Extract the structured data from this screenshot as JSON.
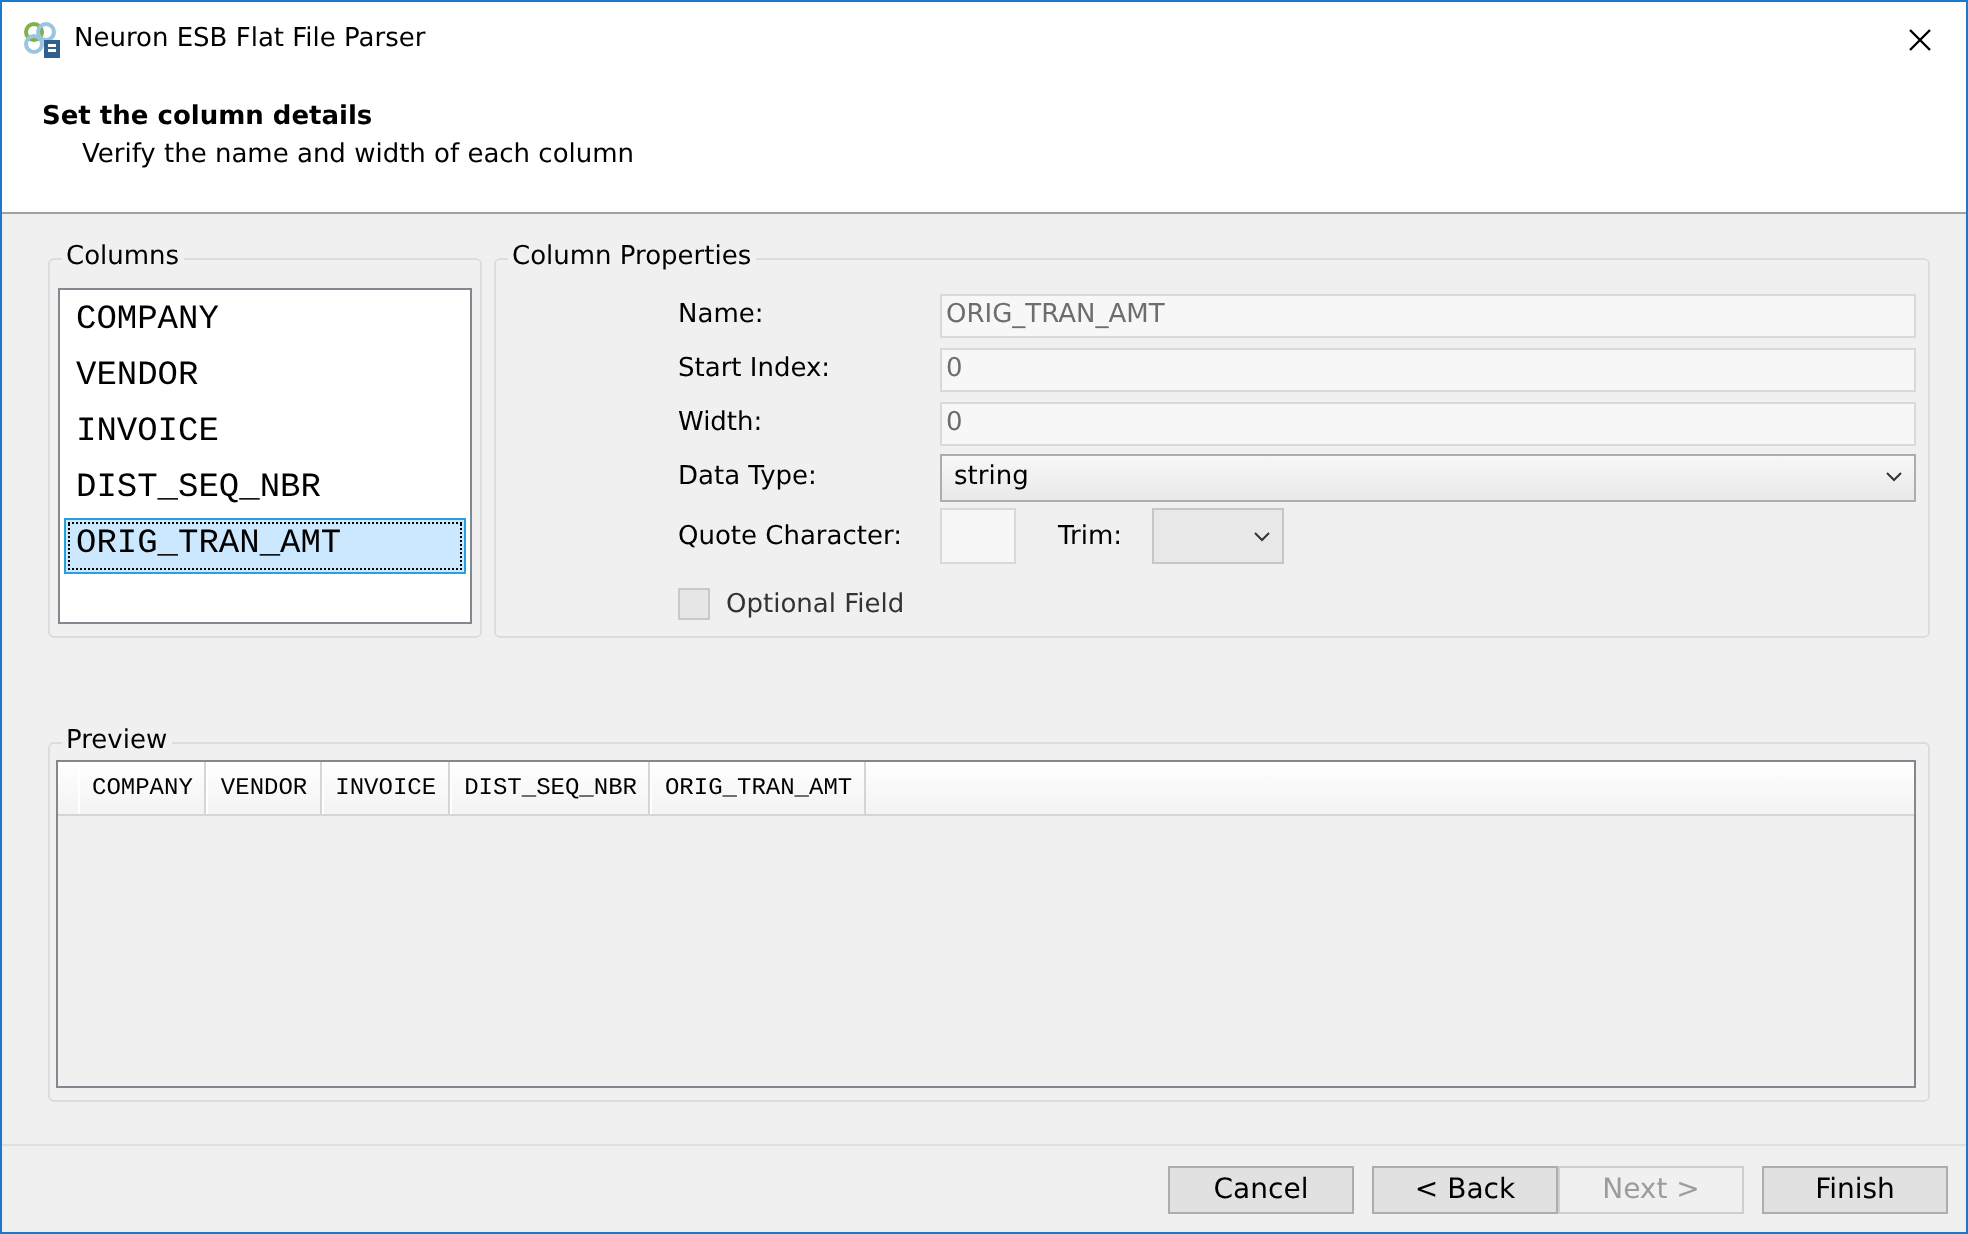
{
  "window": {
    "title": "Neuron ESB Flat File Parser"
  },
  "header": {
    "title": "Set the column details",
    "subtitle": "Verify the name and width of each column"
  },
  "columns": {
    "label": "Columns",
    "items": [
      {
        "name": "COMPANY",
        "selected": false
      },
      {
        "name": "VENDOR",
        "selected": false
      },
      {
        "name": "INVOICE",
        "selected": false
      },
      {
        "name": "DIST_SEQ_NBR",
        "selected": false
      },
      {
        "name": "ORIG_TRAN_AMT",
        "selected": true
      }
    ]
  },
  "properties": {
    "label": "Column Properties",
    "name": {
      "label": "Name:",
      "value": "ORIG_TRAN_AMT",
      "disabled": true
    },
    "start_index": {
      "label": "Start Index:",
      "value": "0",
      "disabled": true
    },
    "width": {
      "label": "Width:",
      "value": "0",
      "disabled": true
    },
    "data_type": {
      "label": "Data Type:",
      "value": "string"
    },
    "quote_character": {
      "label": "Quote Character:"
    },
    "trim": {
      "label": "Trim:"
    },
    "optional_field": {
      "label": "Optional Field",
      "checked": false
    }
  },
  "preview": {
    "label": "Preview",
    "columns": [
      "COMPANY",
      "VENDOR",
      "INVOICE",
      "DIST_SEQ_NBR",
      "ORIG_TRAN_AMT"
    ]
  },
  "buttons": [
    {
      "label": "Cancel",
      "disabled": false
    },
    {
      "label": "< Back",
      "disabled": false
    },
    {
      "label": "Next >",
      "disabled": true
    },
    {
      "label": "Finish",
      "disabled": false
    }
  ]
}
